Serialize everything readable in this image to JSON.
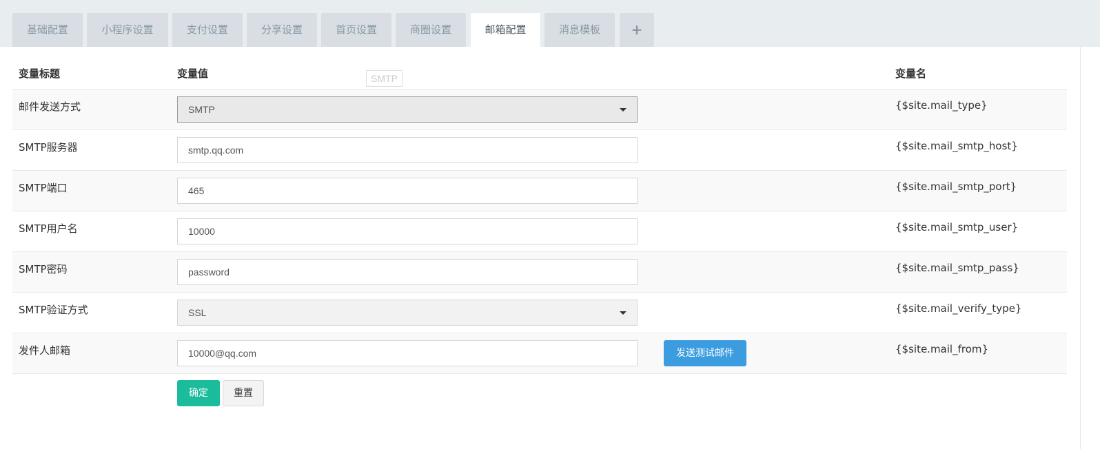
{
  "tabs": [
    {
      "label": "基础配置",
      "active": false
    },
    {
      "label": "小程序设置",
      "active": false
    },
    {
      "label": "支付设置",
      "active": false
    },
    {
      "label": "分享设置",
      "active": false
    },
    {
      "label": "首页设置",
      "active": false
    },
    {
      "label": "商圈设置",
      "active": false
    },
    {
      "label": "邮箱配置",
      "active": true
    },
    {
      "label": "消息模板",
      "active": false
    },
    {
      "label": "+",
      "active": false
    }
  ],
  "table": {
    "headers": {
      "title": "变量标题",
      "value": "变量值",
      "name": "变量名"
    },
    "rows": [
      {
        "title": "邮件发送方式",
        "value": "SMTP",
        "var": "{$site.mail_type}"
      },
      {
        "title": "SMTP服务器",
        "value": "smtp.qq.com",
        "var": "{$site.mail_smtp_host}"
      },
      {
        "title": "SMTP端口",
        "value": "465",
        "var": "{$site.mail_smtp_port}"
      },
      {
        "title": "SMTP用户名",
        "value": "10000",
        "var": "{$site.mail_smtp_user}"
      },
      {
        "title": "SMTP密码",
        "value": "password",
        "var": "{$site.mail_smtp_pass}"
      },
      {
        "title": "SMTP验证方式",
        "value": "SSL",
        "var": "{$site.mail_verify_type}"
      },
      {
        "title": "发件人邮箱",
        "value": "10000@qq.com",
        "var": "{$site.mail_from}"
      }
    ]
  },
  "dropdown_hint": "SMTP",
  "buttons": {
    "send_test": "发送测试邮件",
    "ok": "确定",
    "reset": "重置"
  },
  "colors": {
    "primary": "#1abc9c",
    "info": "#3c9ce0",
    "tab_bg": "#d8dee3",
    "tabbar_bg": "#e8edf0"
  }
}
